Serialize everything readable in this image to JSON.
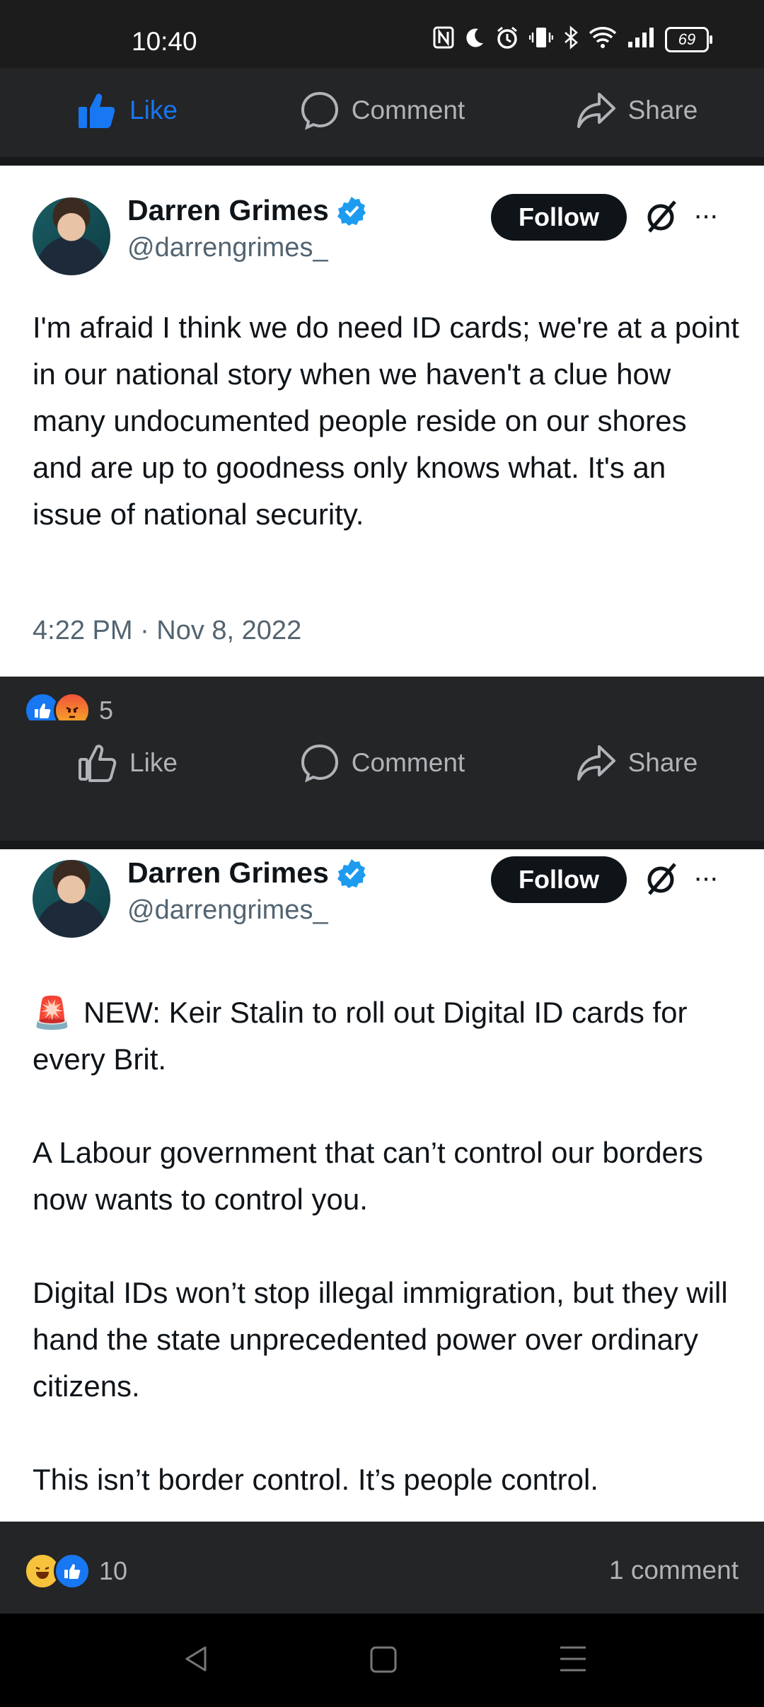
{
  "status_bar": {
    "time": "10:40",
    "battery": "69",
    "icons": [
      "nfc-icon",
      "moon-icon",
      "alarm-icon",
      "vibrate-icon",
      "bluetooth-icon",
      "wifi-icon",
      "signal-icon",
      "battery-icon"
    ]
  },
  "top_actions": {
    "like": "Like",
    "comment": "Comment",
    "share": "Share",
    "like_active_color": "#1877f2"
  },
  "posts": [
    {
      "author_name": "Darren Grimes",
      "handle": "@darrengrimes_",
      "follow_label": "Follow",
      "more": "···",
      "text": "I'm afraid I think we do need ID cards; we're at a point in our national story when we haven't a clue how many undocumented people reside on our shores and are up to goodness only knows what. It's an issue of national security.",
      "timestamp": "4:22 PM · Nov 8, 2022",
      "reaction_count": "5",
      "reactions": [
        "like",
        "angry"
      ],
      "actions": {
        "like": "Like",
        "comment": "Comment",
        "share": "Share"
      }
    },
    {
      "author_name": "Darren Grimes",
      "handle": "@darrengrimes_",
      "follow_label": "Follow",
      "more": "···",
      "siren": "🚨",
      "text": "NEW: Keir Stalin to roll out Digital ID cards for every Brit.\n\nA Labour government that can’t control our borders now wants to control you.\n\nDigital IDs won’t stop illegal immigration, but they will hand the state unprecedented power over ordinary citizens.\n\nThis isn’t border control. It’s people control.",
      "reaction_count": "10",
      "reactions": [
        "haha",
        "like"
      ],
      "comment_count": "1 comment"
    }
  ],
  "colors": {
    "dark_bg": "#242526",
    "verified": "#1d9bf0",
    "muted_text": "#536471"
  }
}
